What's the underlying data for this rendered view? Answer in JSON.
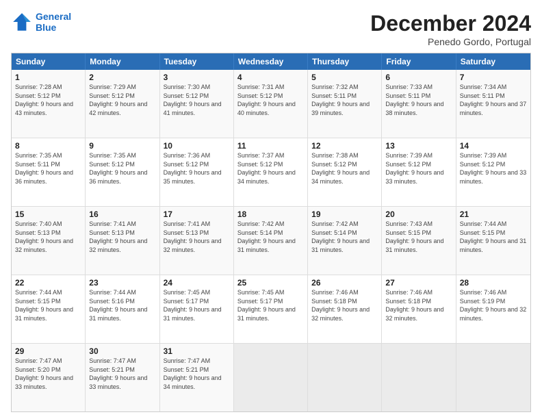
{
  "logo": {
    "line1": "General",
    "line2": "Blue"
  },
  "title": "December 2024",
  "location": "Penedo Gordo, Portugal",
  "days_header": [
    "Sunday",
    "Monday",
    "Tuesday",
    "Wednesday",
    "Thursday",
    "Friday",
    "Saturday"
  ],
  "weeks": [
    [
      {
        "day": "1",
        "sunrise": "7:28 AM",
        "sunset": "5:12 PM",
        "daylight": "9 hours and 43 minutes."
      },
      {
        "day": "2",
        "sunrise": "7:29 AM",
        "sunset": "5:12 PM",
        "daylight": "9 hours and 42 minutes."
      },
      {
        "day": "3",
        "sunrise": "7:30 AM",
        "sunset": "5:12 PM",
        "daylight": "9 hours and 41 minutes."
      },
      {
        "day": "4",
        "sunrise": "7:31 AM",
        "sunset": "5:12 PM",
        "daylight": "9 hours and 40 minutes."
      },
      {
        "day": "5",
        "sunrise": "7:32 AM",
        "sunset": "5:11 PM",
        "daylight": "9 hours and 39 minutes."
      },
      {
        "day": "6",
        "sunrise": "7:33 AM",
        "sunset": "5:11 PM",
        "daylight": "9 hours and 38 minutes."
      },
      {
        "day": "7",
        "sunrise": "7:34 AM",
        "sunset": "5:11 PM",
        "daylight": "9 hours and 37 minutes."
      }
    ],
    [
      {
        "day": "8",
        "sunrise": "7:35 AM",
        "sunset": "5:11 PM",
        "daylight": "9 hours and 36 minutes."
      },
      {
        "day": "9",
        "sunrise": "7:35 AM",
        "sunset": "5:12 PM",
        "daylight": "9 hours and 36 minutes."
      },
      {
        "day": "10",
        "sunrise": "7:36 AM",
        "sunset": "5:12 PM",
        "daylight": "9 hours and 35 minutes."
      },
      {
        "day": "11",
        "sunrise": "7:37 AM",
        "sunset": "5:12 PM",
        "daylight": "9 hours and 34 minutes."
      },
      {
        "day": "12",
        "sunrise": "7:38 AM",
        "sunset": "5:12 PM",
        "daylight": "9 hours and 34 minutes."
      },
      {
        "day": "13",
        "sunrise": "7:39 AM",
        "sunset": "5:12 PM",
        "daylight": "9 hours and 33 minutes."
      },
      {
        "day": "14",
        "sunrise": "7:39 AM",
        "sunset": "5:12 PM",
        "daylight": "9 hours and 33 minutes."
      }
    ],
    [
      {
        "day": "15",
        "sunrise": "7:40 AM",
        "sunset": "5:13 PM",
        "daylight": "9 hours and 32 minutes."
      },
      {
        "day": "16",
        "sunrise": "7:41 AM",
        "sunset": "5:13 PM",
        "daylight": "9 hours and 32 minutes."
      },
      {
        "day": "17",
        "sunrise": "7:41 AM",
        "sunset": "5:13 PM",
        "daylight": "9 hours and 32 minutes."
      },
      {
        "day": "18",
        "sunrise": "7:42 AM",
        "sunset": "5:14 PM",
        "daylight": "9 hours and 31 minutes."
      },
      {
        "day": "19",
        "sunrise": "7:42 AM",
        "sunset": "5:14 PM",
        "daylight": "9 hours and 31 minutes."
      },
      {
        "day": "20",
        "sunrise": "7:43 AM",
        "sunset": "5:15 PM",
        "daylight": "9 hours and 31 minutes."
      },
      {
        "day": "21",
        "sunrise": "7:44 AM",
        "sunset": "5:15 PM",
        "daylight": "9 hours and 31 minutes."
      }
    ],
    [
      {
        "day": "22",
        "sunrise": "7:44 AM",
        "sunset": "5:15 PM",
        "daylight": "9 hours and 31 minutes."
      },
      {
        "day": "23",
        "sunrise": "7:44 AM",
        "sunset": "5:16 PM",
        "daylight": "9 hours and 31 minutes."
      },
      {
        "day": "24",
        "sunrise": "7:45 AM",
        "sunset": "5:17 PM",
        "daylight": "9 hours and 31 minutes."
      },
      {
        "day": "25",
        "sunrise": "7:45 AM",
        "sunset": "5:17 PM",
        "daylight": "9 hours and 31 minutes."
      },
      {
        "day": "26",
        "sunrise": "7:46 AM",
        "sunset": "5:18 PM",
        "daylight": "9 hours and 32 minutes."
      },
      {
        "day": "27",
        "sunrise": "7:46 AM",
        "sunset": "5:18 PM",
        "daylight": "9 hours and 32 minutes."
      },
      {
        "day": "28",
        "sunrise": "7:46 AM",
        "sunset": "5:19 PM",
        "daylight": "9 hours and 32 minutes."
      }
    ],
    [
      {
        "day": "29",
        "sunrise": "7:47 AM",
        "sunset": "5:20 PM",
        "daylight": "9 hours and 33 minutes."
      },
      {
        "day": "30",
        "sunrise": "7:47 AM",
        "sunset": "5:21 PM",
        "daylight": "9 hours and 33 minutes."
      },
      {
        "day": "31",
        "sunrise": "7:47 AM",
        "sunset": "5:21 PM",
        "daylight": "9 hours and 34 minutes."
      },
      null,
      null,
      null,
      null
    ]
  ]
}
